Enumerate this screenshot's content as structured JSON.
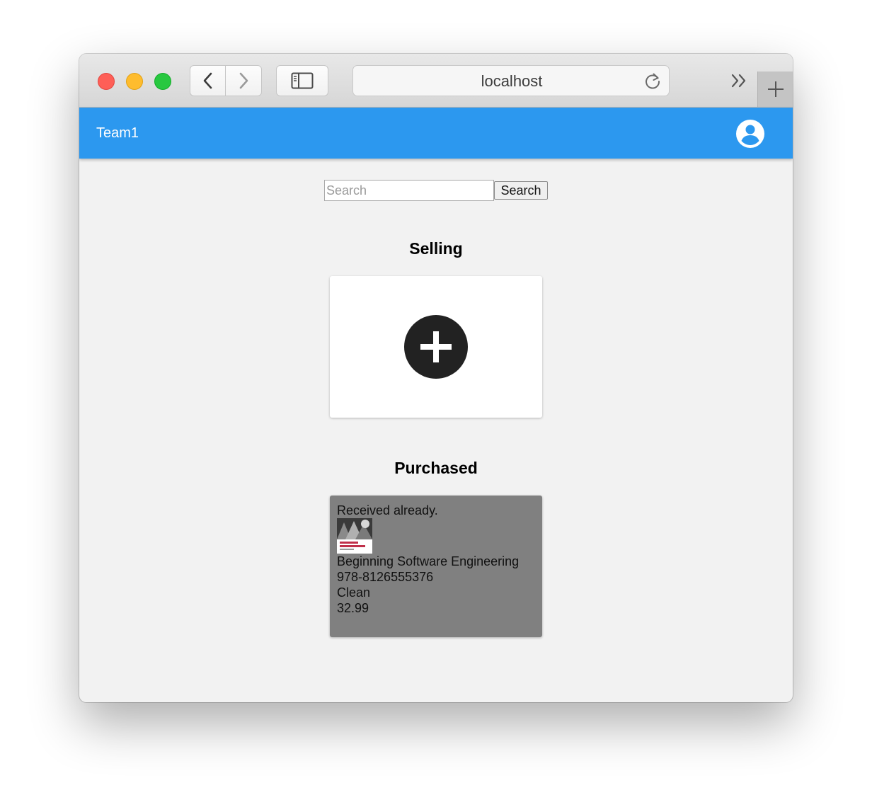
{
  "browser": {
    "address_text": "localhost"
  },
  "appbar": {
    "brand": "Team1"
  },
  "search": {
    "placeholder": "Search",
    "value": "",
    "button_label": "Search"
  },
  "selling": {
    "title": "Selling",
    "add_icon": "plus-circle-icon"
  },
  "purchased": {
    "title": "Purchased",
    "items": [
      {
        "status": "Received already.",
        "cover_icon": "book-cover-image",
        "title": "Beginning Software Engineering",
        "isbn": "978-8126555376",
        "condition": "Clean",
        "price": "32.99"
      }
    ]
  },
  "colors": {
    "appbar": "#2c98ef",
    "background": "#f2f2f2",
    "purchase_card": "#808080"
  }
}
